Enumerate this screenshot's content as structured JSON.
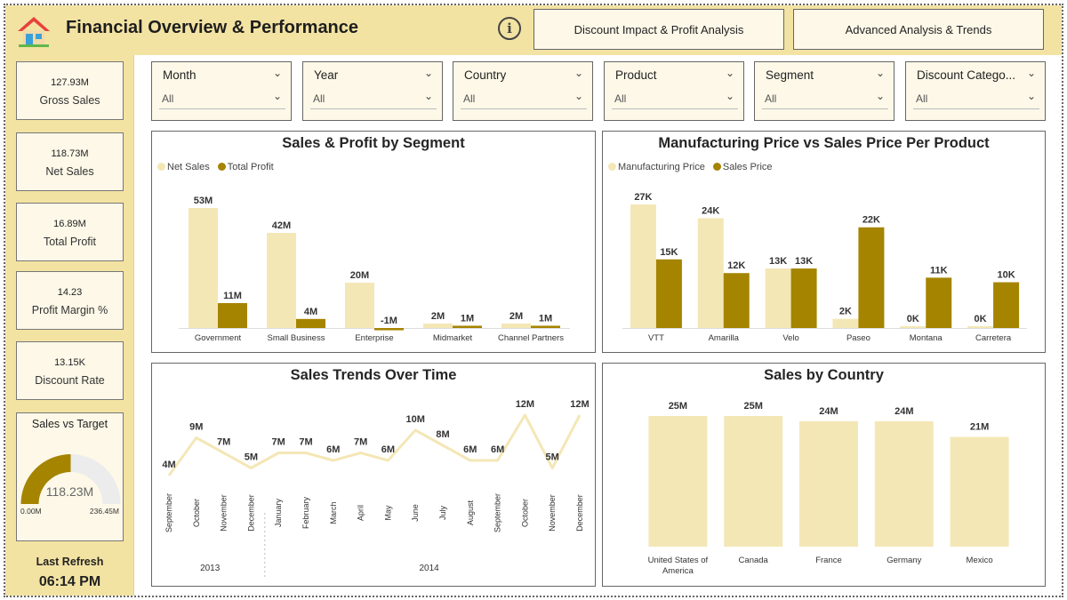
{
  "header": {
    "title": "Financial Overview & Performance",
    "logo_icon": "house-icon",
    "info_icon": "info-icon",
    "info_glyph": "i",
    "nav_buttons": [
      "Discount Impact & Profit Analysis",
      "Advanced Analysis & Trends"
    ]
  },
  "colors": {
    "header_bg": "#f3e3a3",
    "light_series": "#f4e7b6",
    "dark_series": "#a58400",
    "panel_bg": "#fdf8e8"
  },
  "kpis": [
    {
      "value": "127.93M",
      "label": "Gross Sales"
    },
    {
      "value": "118.73M",
      "label": "Net Sales"
    },
    {
      "value": "16.89M",
      "label": "Total Profit"
    },
    {
      "value": "14.23",
      "label": "Profit Margin %"
    },
    {
      "value": "13.15K",
      "label": "Discount Rate"
    }
  ],
  "gauge": {
    "title": "Sales vs Target",
    "value_label": "118.23M",
    "value": 118.23,
    "min": 0,
    "max": 236.45,
    "min_label": "0.00M",
    "max_label": "236.45M"
  },
  "refresh": {
    "label": "Last Refresh",
    "time": "06:14 PM"
  },
  "slicers": [
    {
      "title": "Month",
      "selected": "All"
    },
    {
      "title": "Year",
      "selected": "All"
    },
    {
      "title": "Country",
      "selected": "All"
    },
    {
      "title": "Product",
      "selected": "All"
    },
    {
      "title": "Segment",
      "selected": "All"
    },
    {
      "title": "Discount Catego...",
      "selected": "All"
    }
  ],
  "chart_data": [
    {
      "type": "bar",
      "title": "Sales & Profit by Segment",
      "categories": [
        "Government",
        "Small Business",
        "Enterprise",
        "Midmarket",
        "Channel Partners"
      ],
      "series": [
        {
          "name": "Net Sales",
          "values": [
            53,
            42,
            20,
            2,
            2
          ],
          "labels": [
            "53M",
            "42M",
            "20M",
            "2M",
            "2M"
          ]
        },
        {
          "name": "Total Profit",
          "values": [
            11,
            4,
            -1,
            1,
            1
          ],
          "labels": [
            "11M",
            "4M",
            "-1M",
            "1M",
            "1M"
          ]
        }
      ],
      "unit": "M"
    },
    {
      "type": "bar",
      "title": "Manufacturing Price vs Sales Price Per Product",
      "categories": [
        "VTT",
        "Amarilla",
        "Velo",
        "Paseo",
        "Montana",
        "Carretera"
      ],
      "series": [
        {
          "name": "Manufacturing Price",
          "values": [
            27,
            24,
            13,
            2,
            0.3,
            0.3
          ],
          "labels": [
            "27K",
            "24K",
            "13K",
            "2K",
            "0K",
            "0K"
          ]
        },
        {
          "name": "Sales Price",
          "values": [
            15,
            12,
            13,
            22,
            11,
            10
          ],
          "labels": [
            "15K",
            "12K",
            "13K",
            "22K",
            "11K",
            "10K"
          ]
        }
      ],
      "unit": "K"
    },
    {
      "type": "line",
      "title": "Sales Trends Over Time",
      "x": [
        "September",
        "October",
        "November",
        "December",
        "January",
        "February",
        "March",
        "April",
        "May",
        "June",
        "July",
        "August",
        "September",
        "October",
        "November",
        "December"
      ],
      "years": [
        {
          "label": "2013",
          "count": 4
        },
        {
          "label": "2014",
          "count": 12
        }
      ],
      "values": [
        4,
        9,
        7,
        5,
        7,
        7,
        6,
        7,
        6,
        10,
        8,
        6,
        6,
        12,
        5,
        12
      ],
      "labels": [
        "4M",
        "9M",
        "7M",
        "5M",
        "7M",
        "7M",
        "6M",
        "7M",
        "6M",
        "10M",
        "8M",
        "6M",
        "6M",
        "12M",
        "5M",
        "12M"
      ]
    },
    {
      "type": "bar",
      "title": "Sales by Country",
      "categories": [
        "United States of America",
        "Canada",
        "France",
        "Germany",
        "Mexico"
      ],
      "values": [
        25,
        25,
        24,
        24,
        21
      ],
      "labels": [
        "25M",
        "25M",
        "24M",
        "24M",
        "21M"
      ]
    }
  ]
}
